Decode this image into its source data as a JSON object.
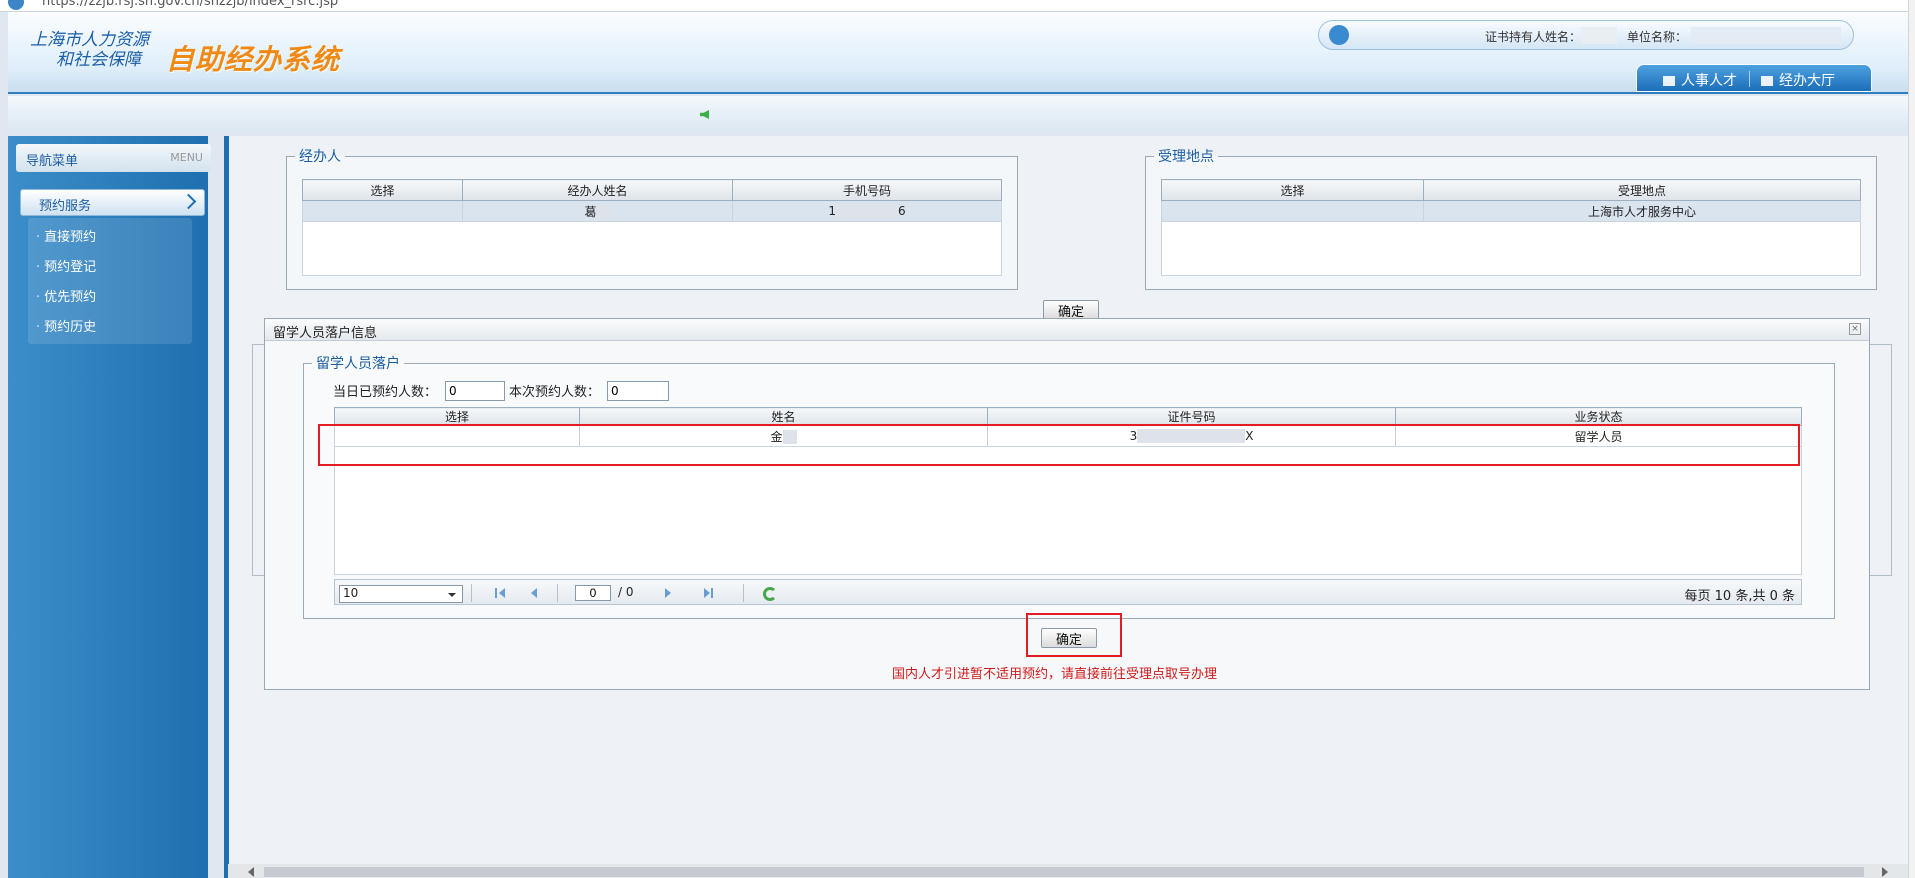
{
  "browser": {
    "url": "https://zzjb.rsj.sh.gov.cn/shzzjb/index_rsrc.jsp"
  },
  "header": {
    "org_line1": "上海市人力资源",
    "org_line2": "和社会保障",
    "system_name": "自助经办系统",
    "holder_label": "证书持有人姓名：",
    "unit_label": "单位名称：",
    "tabs": [
      {
        "label": "人事人才"
      },
      {
        "label": "经办大厅"
      }
    ]
  },
  "sidebar": {
    "title": "导航菜单",
    "title_en": "MENU",
    "section": "预约服务",
    "items": [
      {
        "label": "直接预约"
      },
      {
        "label": "预约登记"
      },
      {
        "label": "优先预约"
      },
      {
        "label": "预约历史"
      }
    ]
  },
  "handler": {
    "legend": "经办人",
    "columns": [
      "选择",
      "经办人姓名",
      "手机号码"
    ],
    "row": {
      "name_visible": "葛",
      "phone_prefix": "1",
      "phone_suffix": "6"
    }
  },
  "location": {
    "legend": "受理地点",
    "columns": [
      "选择",
      "受理地点"
    ],
    "row": {
      "place": "上海市人才服务中心"
    }
  },
  "confirm_top": "确定",
  "modal": {
    "title": "留学人员落户信息",
    "close": "×",
    "legend": "留学人员落户",
    "today_label": "当日已预约人数：",
    "today_value": "0",
    "this_label": "本次预约人数：",
    "this_value": "0",
    "columns": [
      "选择",
      "姓名",
      "证件号码",
      "业务状态"
    ],
    "row": {
      "name_visible": "金",
      "id_prefix": "3",
      "id_suffix": "X",
      "status": "留学人员"
    },
    "pager": {
      "page_size": "10",
      "current": "0",
      "total": "/ 0",
      "info": "每页 10 条,共 0 条"
    },
    "confirm": "确定",
    "warning": "国内人才引进暂不适用预约，请直接前往受理点取号办理"
  },
  "colors": {
    "accent": "#1f6fb0",
    "warning": "#d01a1a",
    "highlight_box": "#e41d23",
    "logo_orange": "#f08a14"
  }
}
